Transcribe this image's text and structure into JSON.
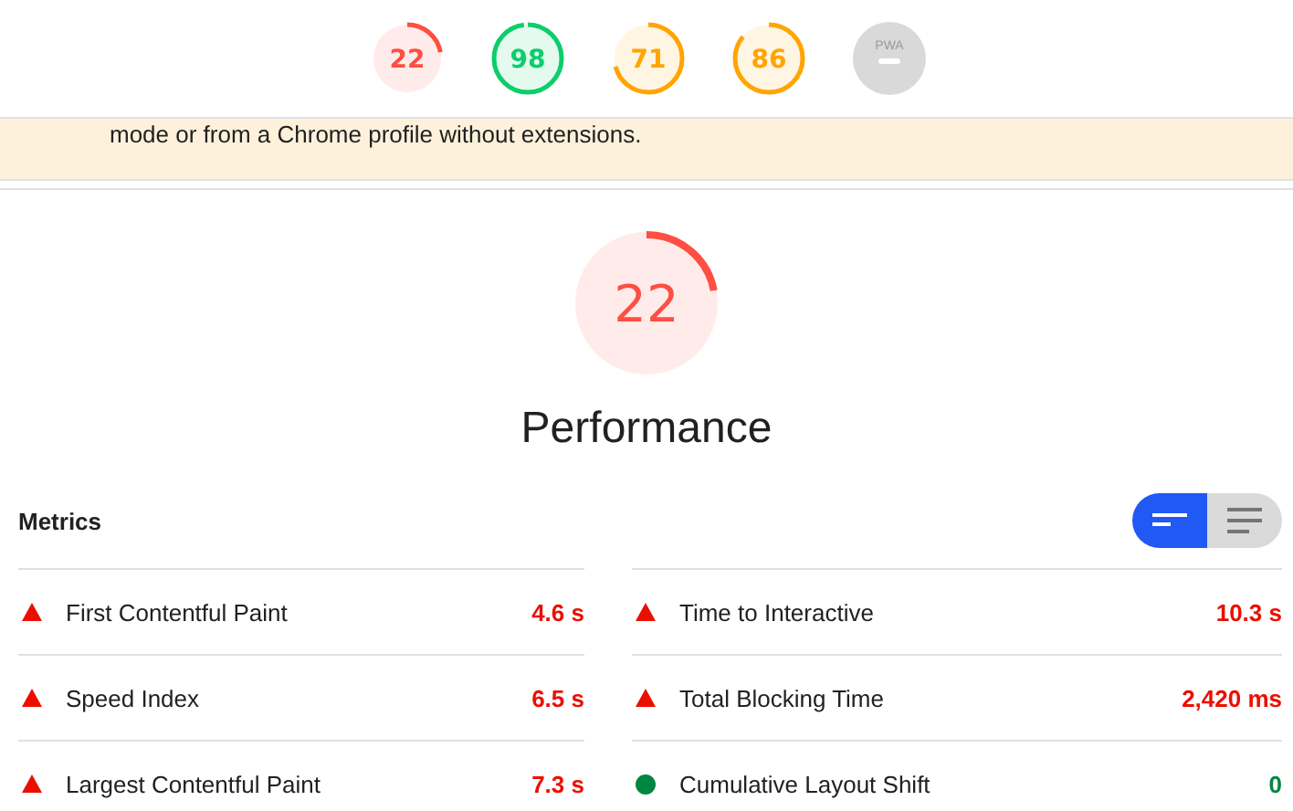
{
  "gauges": [
    {
      "kind": "score",
      "score": "22",
      "color": "#ff4e42"
    },
    {
      "kind": "score",
      "score": "98",
      "color": "#0cce6b"
    },
    {
      "kind": "score",
      "score": "71",
      "color": "#ffa400"
    },
    {
      "kind": "score",
      "score": "86",
      "color": "#ffa400"
    },
    {
      "kind": "pwa",
      "label": "PWA"
    }
  ],
  "warning": {
    "text": "mode or from a Chrome profile without extensions."
  },
  "category": {
    "score": "22",
    "color": "#ff4e42",
    "title": "Performance"
  },
  "metrics": {
    "title": "Metrics",
    "view_toggle": [
      {
        "kind": "compact",
        "selected": true
      },
      {
        "kind": "expanded",
        "selected": false
      }
    ],
    "items": [
      {
        "name": "First Contentful Paint",
        "value": "4.6 s",
        "kind": "triangle",
        "color": "#eb0f00"
      },
      {
        "name": "Time to Interactive",
        "value": "10.3 s",
        "kind": "triangle",
        "color": "#eb0f00"
      },
      {
        "name": "Speed Index",
        "value": "6.5 s",
        "kind": "triangle",
        "color": "#eb0f00"
      },
      {
        "name": "Total Blocking Time",
        "value": "2,420 ms",
        "kind": "triangle",
        "color": "#eb0f00"
      },
      {
        "name": "Largest Contentful Paint",
        "value": "7.3 s",
        "kind": "triangle",
        "color": "#eb0f00"
      },
      {
        "name": "Cumulative Layout Shift",
        "value": "0",
        "kind": "circle",
        "color": "#018642"
      }
    ]
  }
}
